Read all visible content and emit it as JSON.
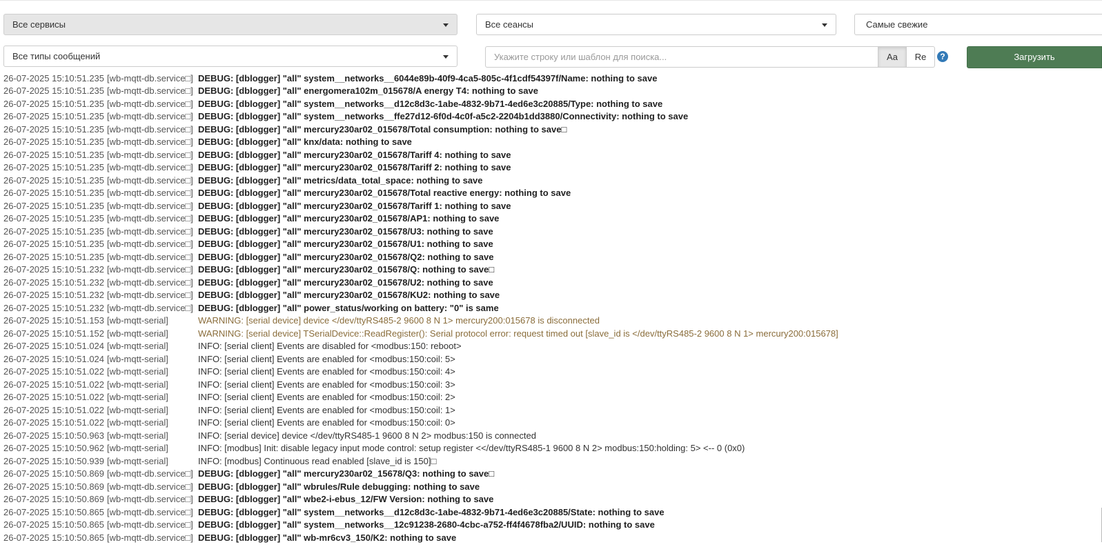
{
  "filters": {
    "services": "Все сервисы",
    "sessions": "Все сеансы",
    "sort": "Самые свежие",
    "message_types": "Все типы сообщений"
  },
  "search": {
    "placeholder": "Укажите строку или шаблон для поиска...",
    "case_label": "Aa",
    "regex_label": "Re",
    "help_label": "?"
  },
  "load_label": "Загрузить",
  "log_rows": [
    {
      "level": "debug",
      "time": "26-07-2025 15:10:51.235",
      "service": "[wb-mqtt-db.service□]",
      "message": "DEBUG: [dblogger] \"all\" system__networks__6044e89b-40f9-4ca5-805c-4f1cdf54397f/Name: nothing to save"
    },
    {
      "level": "debug",
      "time": "26-07-2025 15:10:51.235",
      "service": "[wb-mqtt-db.service□]",
      "message": "DEBUG: [dblogger] \"all\" energomera102m_015678/A energy T4: nothing to save"
    },
    {
      "level": "debug",
      "time": "26-07-2025 15:10:51.235",
      "service": "[wb-mqtt-db.service□]",
      "message": "DEBUG: [dblogger] \"all\" system__networks__d12c8d3c-1abe-4832-9b71-4ed6e3c20885/Type: nothing to save"
    },
    {
      "level": "debug",
      "time": "26-07-2025 15:10:51.235",
      "service": "[wb-mqtt-db.service□]",
      "message": "DEBUG: [dblogger] \"all\" system__networks__ffe27d12-6f0d-4c0f-a5c2-2204b1dd3880/Connectivity: nothing to save"
    },
    {
      "level": "debug",
      "time": "26-07-2025 15:10:51.235",
      "service": "[wb-mqtt-db.service□]",
      "message": "DEBUG: [dblogger] \"all\" mercury230ar02_015678/Total consumption: nothing to save□"
    },
    {
      "level": "debug",
      "time": "26-07-2025 15:10:51.235",
      "service": "[wb-mqtt-db.service□]",
      "message": "DEBUG: [dblogger] \"all\" knx/data: nothing to save"
    },
    {
      "level": "debug",
      "time": "26-07-2025 15:10:51.235",
      "service": "[wb-mqtt-db.service□]",
      "message": "DEBUG: [dblogger] \"all\" mercury230ar02_015678/Tariff 4: nothing to save"
    },
    {
      "level": "debug",
      "time": "26-07-2025 15:10:51.235",
      "service": "[wb-mqtt-db.service□]",
      "message": "DEBUG: [dblogger] \"all\" mercury230ar02_015678/Tariff 2: nothing to save"
    },
    {
      "level": "debug",
      "time": "26-07-2025 15:10:51.235",
      "service": "[wb-mqtt-db.service□]",
      "message": "DEBUG: [dblogger] \"all\" metrics/data_total_space: nothing to save"
    },
    {
      "level": "debug",
      "time": "26-07-2025 15:10:51.235",
      "service": "[wb-mqtt-db.service□]",
      "message": "DEBUG: [dblogger] \"all\" mercury230ar02_015678/Total reactive energy: nothing to save"
    },
    {
      "level": "debug",
      "time": "26-07-2025 15:10:51.235",
      "service": "[wb-mqtt-db.service□]",
      "message": "DEBUG: [dblogger] \"all\" mercury230ar02_015678/Tariff 1: nothing to save"
    },
    {
      "level": "debug",
      "time": "26-07-2025 15:10:51.235",
      "service": "[wb-mqtt-db.service□]",
      "message": "DEBUG: [dblogger] \"all\" mercury230ar02_015678/AP1: nothing to save"
    },
    {
      "level": "debug",
      "time": "26-07-2025 15:10:51.235",
      "service": "[wb-mqtt-db.service□]",
      "message": "DEBUG: [dblogger] \"all\" mercury230ar02_015678/U3: nothing to save"
    },
    {
      "level": "debug",
      "time": "26-07-2025 15:10:51.235",
      "service": "[wb-mqtt-db.service□]",
      "message": "DEBUG: [dblogger] \"all\" mercury230ar02_015678/U1: nothing to save"
    },
    {
      "level": "debug",
      "time": "26-07-2025 15:10:51.235",
      "service": "[wb-mqtt-db.service□]",
      "message": "DEBUG: [dblogger] \"all\" mercury230ar02_015678/Q2: nothing to save"
    },
    {
      "level": "debug",
      "time": "26-07-2025 15:10:51.232",
      "service": "[wb-mqtt-db.service□]",
      "message": "DEBUG: [dblogger] \"all\" mercury230ar02_015678/Q: nothing to save□"
    },
    {
      "level": "debug",
      "time": "26-07-2025 15:10:51.232",
      "service": "[wb-mqtt-db.service□]",
      "message": "DEBUG: [dblogger] \"all\" mercury230ar02_015678/U2: nothing to save"
    },
    {
      "level": "debug",
      "time": "26-07-2025 15:10:51.232",
      "service": "[wb-mqtt-db.service□]",
      "message": "DEBUG: [dblogger] \"all\" mercury230ar02_015678/KU2: nothing to save"
    },
    {
      "level": "debug",
      "time": "26-07-2025 15:10:51.232",
      "service": "[wb-mqtt-db.service□]",
      "message": "DEBUG: [dblogger] \"all\" power_status/working on battery: \"0\" is same"
    },
    {
      "level": "warning",
      "time": "26-07-2025 15:10:51.153",
      "service": "[wb-mqtt-serial]",
      "message": "WARNING: [serial device] device </dev/ttyRS485-2 9600 8 N 1> mercury200:015678 is disconnected"
    },
    {
      "level": "warning",
      "time": "26-07-2025 15:10:51.152",
      "service": "[wb-mqtt-serial]",
      "message": "WARNING: [serial device] TSerialDevice::ReadRegister(): Serial protocol error: request timed out [slave_id is </dev/ttyRS485-2 9600 8 N 1> mercury200:015678]"
    },
    {
      "level": "info",
      "time": "26-07-2025 15:10:51.024",
      "service": "[wb-mqtt-serial]",
      "message": "INFO: [serial client] Events are disabled for <modbus:150: reboot>"
    },
    {
      "level": "info",
      "time": "26-07-2025 15:10:51.024",
      "service": "[wb-mqtt-serial]",
      "message": "INFO: [serial client] Events are enabled for <modbus:150:coil: 5>"
    },
    {
      "level": "info",
      "time": "26-07-2025 15:10:51.022",
      "service": "[wb-mqtt-serial]",
      "message": "INFO: [serial client] Events are enabled for <modbus:150:coil: 4>"
    },
    {
      "level": "info",
      "time": "26-07-2025 15:10:51.022",
      "service": "[wb-mqtt-serial]",
      "message": "INFO: [serial client] Events are enabled for <modbus:150:coil: 3>"
    },
    {
      "level": "info",
      "time": "26-07-2025 15:10:51.022",
      "service": "[wb-mqtt-serial]",
      "message": "INFO: [serial client] Events are enabled for <modbus:150:coil: 2>"
    },
    {
      "level": "info",
      "time": "26-07-2025 15:10:51.022",
      "service": "[wb-mqtt-serial]",
      "message": "INFO: [serial client] Events are enabled for <modbus:150:coil: 1>"
    },
    {
      "level": "info",
      "time": "26-07-2025 15:10:51.022",
      "service": "[wb-mqtt-serial]",
      "message": "INFO: [serial client] Events are enabled for <modbus:150:coil: 0>"
    },
    {
      "level": "info",
      "time": "26-07-2025 15:10:50.963",
      "service": "[wb-mqtt-serial]",
      "message": "INFO: [serial device] device </dev/ttyRS485-1 9600 8 N 2> modbus:150 is connected"
    },
    {
      "level": "info",
      "time": "26-07-2025 15:10:50.962",
      "service": "[wb-mqtt-serial]",
      "message": "INFO: [modbus] Init: disable legacy input mode control: setup register <</dev/ttyRS485-1 9600 8 N 2> modbus:150:holding: 5> <-- 0 (0x0)"
    },
    {
      "level": "info",
      "time": "26-07-2025 15:10:50.939",
      "service": "[wb-mqtt-serial]",
      "message": "INFO: [modbus] Continuous read enabled [slave_id is 150]□"
    },
    {
      "level": "debug",
      "time": "26-07-2025 15:10:50.869",
      "service": "[wb-mqtt-db.service□]",
      "message": "DEBUG: [dblogger] \"all\" mercury230ar02_15678/Q3: nothing to save□"
    },
    {
      "level": "debug",
      "time": "26-07-2025 15:10:50.869",
      "service": "[wb-mqtt-db.service□]",
      "message": "DEBUG: [dblogger] \"all\" wbrules/Rule debugging: nothing to save"
    },
    {
      "level": "debug",
      "time": "26-07-2025 15:10:50.869",
      "service": "[wb-mqtt-db.service□]",
      "message": "DEBUG: [dblogger] \"all\" wbe2-i-ebus_12/FW Version: nothing to save"
    },
    {
      "level": "debug",
      "time": "26-07-2025 15:10:50.865",
      "service": "[wb-mqtt-db.service□]",
      "message": "DEBUG: [dblogger] \"all\" system__networks__d12c8d3c-1abe-4832-9b71-4ed6e3c20885/State: nothing to save"
    },
    {
      "level": "debug",
      "time": "26-07-2025 15:10:50.865",
      "service": "[wb-mqtt-db.service□]",
      "message": "DEBUG: [dblogger] \"all\" system__networks__12c91238-2680-4cbc-a752-ff4f4678fba2/UUID: nothing to save"
    },
    {
      "level": "debug",
      "time": "26-07-2025 15:10:50.865",
      "service": "[wb-mqtt-db.service□]",
      "message": "DEBUG: [dblogger] \"all\" wb-mr6cv3_150/K2: nothing to save"
    }
  ]
}
